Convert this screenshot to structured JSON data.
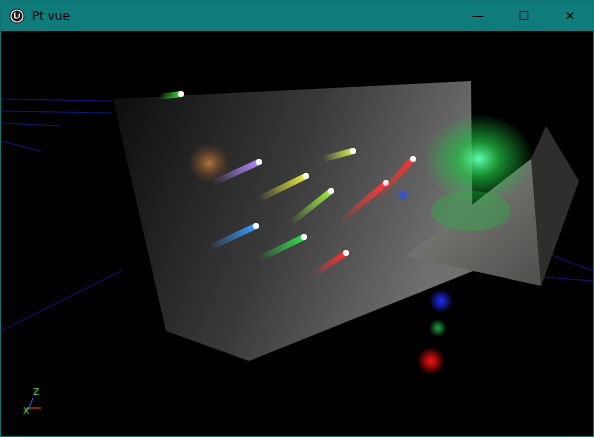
{
  "window": {
    "title": "Pt vue",
    "controls": [
      "—",
      "☐",
      "✕"
    ]
  },
  "viewport": {
    "axes": [
      {
        "label": "Z"
      },
      {
        "label": "X"
      }
    ]
  }
}
